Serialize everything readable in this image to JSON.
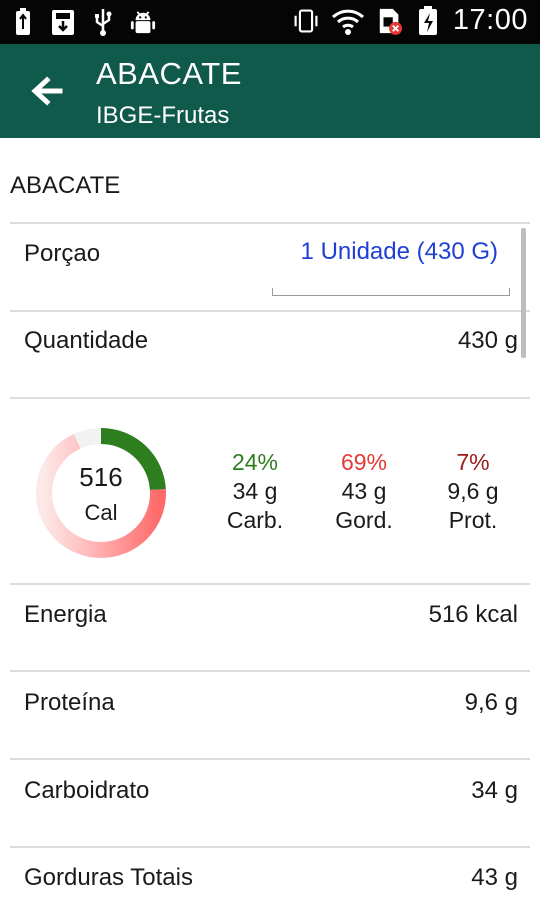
{
  "status_bar": {
    "time": "17:00",
    "left_icons": [
      "usb-battery-icon",
      "download-icon",
      "usb-icon",
      "android-debug-icon"
    ],
    "right_icons": [
      "vibrate-icon",
      "wifi-icon",
      "sim-error-icon",
      "battery-charging-icon"
    ]
  },
  "app_bar": {
    "title": "ABACATE",
    "subtitle": "IBGE-Frutas",
    "background": "#0f5a4b"
  },
  "food": {
    "name": "ABACATE"
  },
  "portion": {
    "label": "Porçao",
    "selected": "1 Unidade (430 G)"
  },
  "quantity": {
    "label": "Quantidade",
    "value": "430 g"
  },
  "summary": {
    "calories": "516",
    "calories_unit": "Cal",
    "macros": [
      {
        "pct": "24%",
        "grams": "34 g",
        "name": "Carb.",
        "color": "#2e7d1f",
        "fraction": 0.24
      },
      {
        "pct": "69%",
        "grams": "43 g",
        "name": "Gord.",
        "color": "#e53935",
        "fraction": 0.69
      },
      {
        "pct": "7%",
        "grams": "9,6 g",
        "name": "Prot.",
        "color": "#9e1b1b",
        "fraction": 0.07
      }
    ]
  },
  "nutrients": [
    {
      "label": "Energia",
      "value": "516 kcal"
    },
    {
      "label": "Proteína",
      "value": "9,6 g"
    },
    {
      "label": "Carboidrato",
      "value": "34 g"
    },
    {
      "label": "Gorduras Totais",
      "value": "43 g"
    }
  ]
}
